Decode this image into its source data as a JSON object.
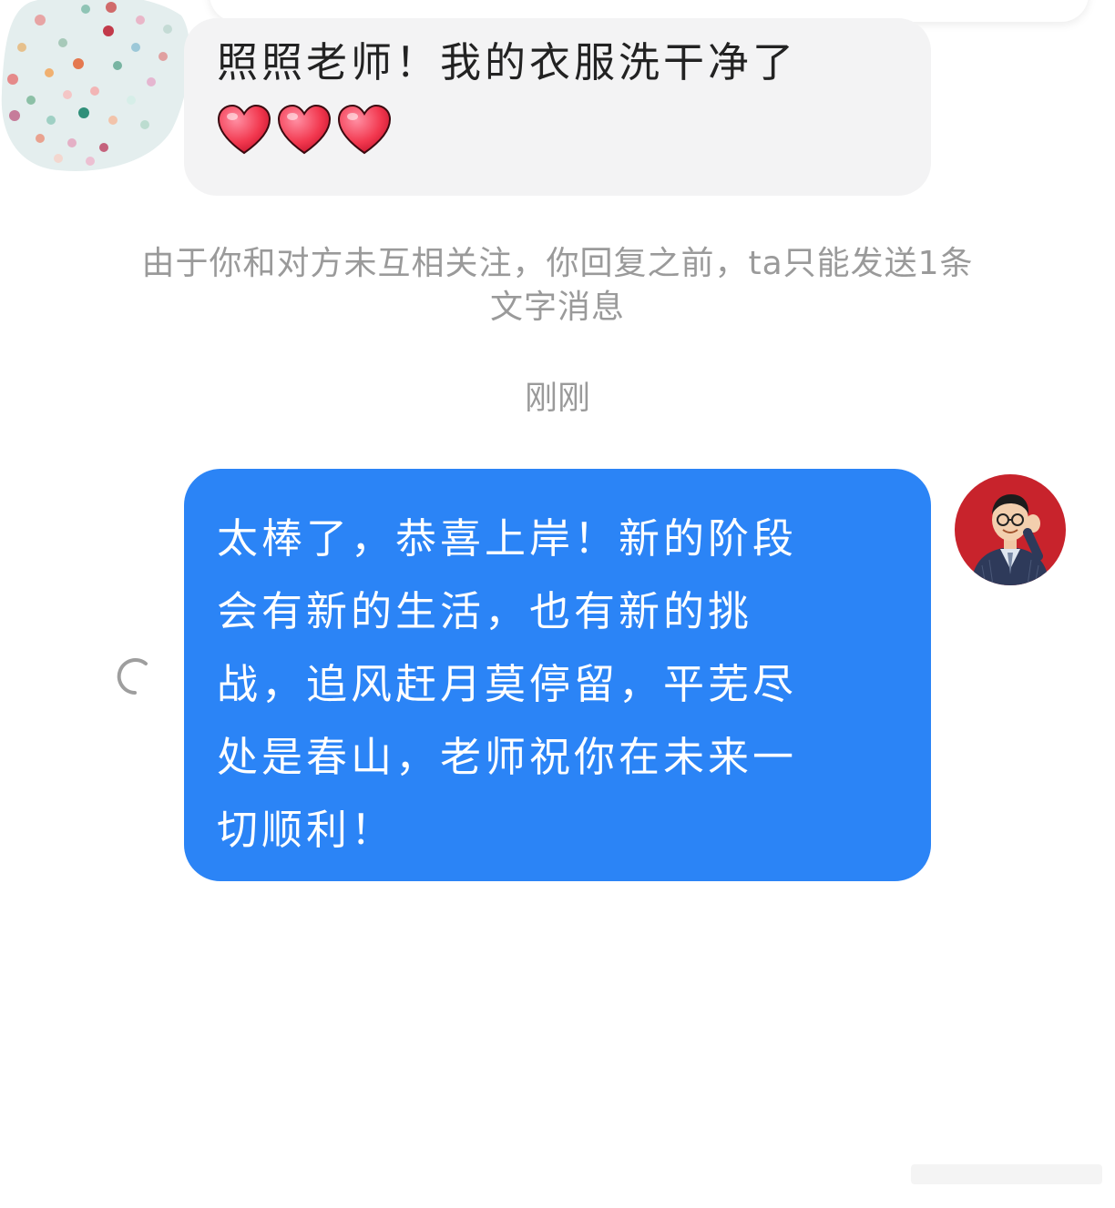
{
  "received_message": {
    "text": "照照老师！我的衣服洗干净了",
    "hearts": [
      "heart-emoji",
      "heart-emoji",
      "heart-emoji"
    ]
  },
  "system_notice": {
    "line1": "由于你和对方未互相关注，你回复之前，ta只能发送1条",
    "line2": "文字消息"
  },
  "timestamp": "刚刚",
  "sent_message": {
    "lines": [
      "太棒了，恭喜上岸！新的阶段",
      "会有新的生活，也有新的挑",
      "战，追风赶月莫停留，平芜尽",
      "处是春山，老师祝你在未来一",
      "切顺利！"
    ],
    "status_icon": "loading-spinner-icon"
  },
  "colors": {
    "sent_bubble": "#2b84f6",
    "received_bubble": "#f3f3f4",
    "notice_text": "#9a9a9a"
  }
}
